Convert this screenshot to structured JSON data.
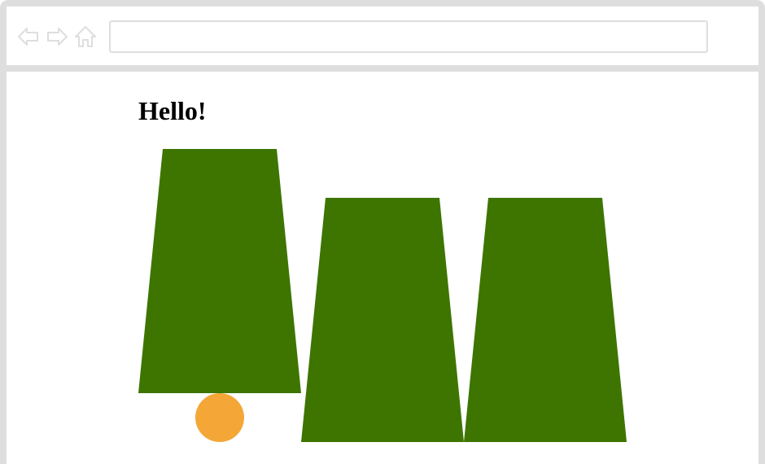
{
  "browser": {
    "address_value": "",
    "icons": {
      "back": "arrow-left-outline-icon",
      "forward": "arrow-right-outline-icon",
      "home": "home-outline-icon"
    },
    "chrome_color": "#dedede"
  },
  "page": {
    "heading": "Hello!"
  },
  "colors": {
    "trapezoid": "#3d7500",
    "circle": "#f4a736",
    "background": "#ffffff"
  }
}
